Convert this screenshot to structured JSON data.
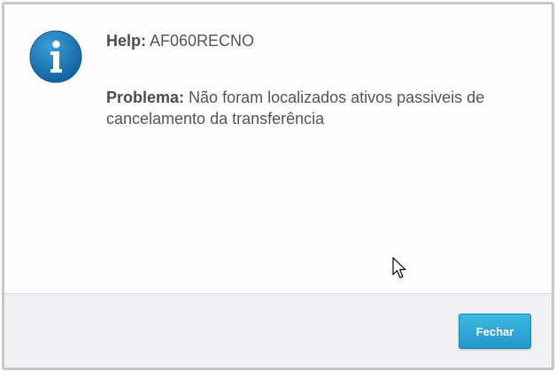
{
  "dialog": {
    "help_label": "Help:",
    "help_code": "AF060RECNO",
    "problem_label": "Problema:",
    "problem_text": "Não foram localizados ativos passiveis de cancelamento da transferência",
    "icon": "info-icon",
    "close_button_label": "Fechar"
  },
  "colors": {
    "accent": "#2aa3d3",
    "icon_blue": "#1f7fbf",
    "text": "#555555"
  }
}
